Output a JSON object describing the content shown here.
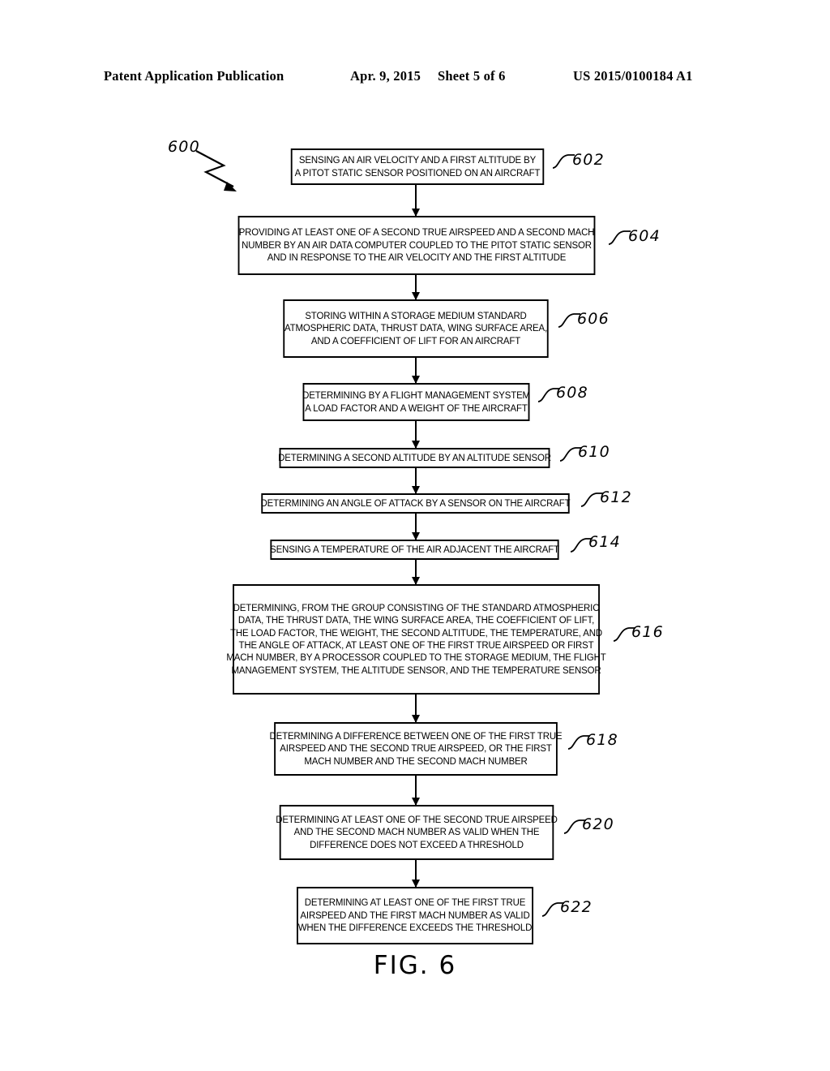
{
  "header": {
    "title": "Patent Application Publication",
    "date": "Apr. 9, 2015",
    "sheet": "Sheet 5 of 6",
    "publication_number": "US 2015/0100184 A1"
  },
  "figure": {
    "caption": "FIG. 6",
    "flow_label": "600",
    "accent_color": "#000000"
  },
  "flowchart": {
    "type": "flowchart",
    "orientation": "top-to-bottom",
    "nodes": [
      {
        "ref": "602",
        "lines": [
          "SENSING AN AIR VELOCITY AND A FIRST ALTITUDE BY",
          "A PITOT STATIC SENSOR POSITIONED ON AN AIRCRAFT"
        ]
      },
      {
        "ref": "604",
        "lines": [
          "PROVIDING AT LEAST ONE OF A SECOND TRUE AIRSPEED AND A SECOND MACH",
          "NUMBER BY AN AIR DATA COMPUTER COUPLED TO THE PITOT STATIC SENSOR",
          "AND IN RESPONSE TO THE AIR VELOCITY AND THE FIRST ALTITUDE"
        ]
      },
      {
        "ref": "606",
        "lines": [
          "STORING WITHIN A STORAGE MEDIUM STANDARD",
          "ATMOSPHERIC DATA, THRUST DATA, WING SURFACE AREA,",
          "AND A COEFFICIENT OF LIFT FOR AN AIRCRAFT"
        ]
      },
      {
        "ref": "608",
        "lines": [
          "DETERMINING BY A FLIGHT MANAGEMENT SYSTEM",
          "A LOAD FACTOR AND A WEIGHT OF THE AIRCRAFT"
        ]
      },
      {
        "ref": "610",
        "lines": [
          "DETERMINING A SECOND ALTITUDE BY AN ALTITUDE SENSOR"
        ]
      },
      {
        "ref": "612",
        "lines": [
          "DETERMINING AN ANGLE OF ATTACK BY A SENSOR ON THE AIRCRAFT"
        ]
      },
      {
        "ref": "614",
        "lines": [
          "SENSING A TEMPERATURE OF THE AIR ADJACENT THE AIRCRAFT"
        ]
      },
      {
        "ref": "616",
        "lines": [
          "DETERMINING, FROM THE GROUP CONSISTING OF THE STANDARD ATMOSPHERIC",
          "DATA, THE THRUST DATA, THE WING SURFACE AREA, THE COEFFICIENT OF LIFT,",
          "THE LOAD FACTOR, THE WEIGHT, THE SECOND ALTITUDE, THE TEMPERATURE, AND",
          "THE ANGLE OF ATTACK, AT LEAST ONE OF THE FIRST TRUE AIRSPEED OR FIRST",
          "MACH NUMBER, BY A PROCESSOR COUPLED TO THE STORAGE MEDIUM, THE FLIGHT",
          "MANAGEMENT SYSTEM, THE ALTITUDE SENSOR, AND THE TEMPERATURE SENSOR"
        ]
      },
      {
        "ref": "618",
        "lines": [
          "DETERMINING A DIFFERENCE BETWEEN ONE OF THE FIRST TRUE",
          "AIRSPEED AND THE SECOND TRUE AIRSPEED, OR THE FIRST",
          "MACH NUMBER AND THE SECOND MACH NUMBER"
        ]
      },
      {
        "ref": "620",
        "lines": [
          "DETERMINING AT LEAST ONE OF THE SECOND TRUE AIRSPEED",
          "AND THE SECOND MACH NUMBER AS VALID WHEN THE",
          "DIFFERENCE DOES NOT EXCEED A THRESHOLD"
        ]
      },
      {
        "ref": "622",
        "lines": [
          "DETERMINING AT LEAST ONE OF THE FIRST TRUE",
          "AIRSPEED AND THE FIRST MACH NUMBER AS VALID",
          "WHEN THE DIFFERENCE EXCEEDS THE THRESHOLD"
        ]
      }
    ]
  }
}
